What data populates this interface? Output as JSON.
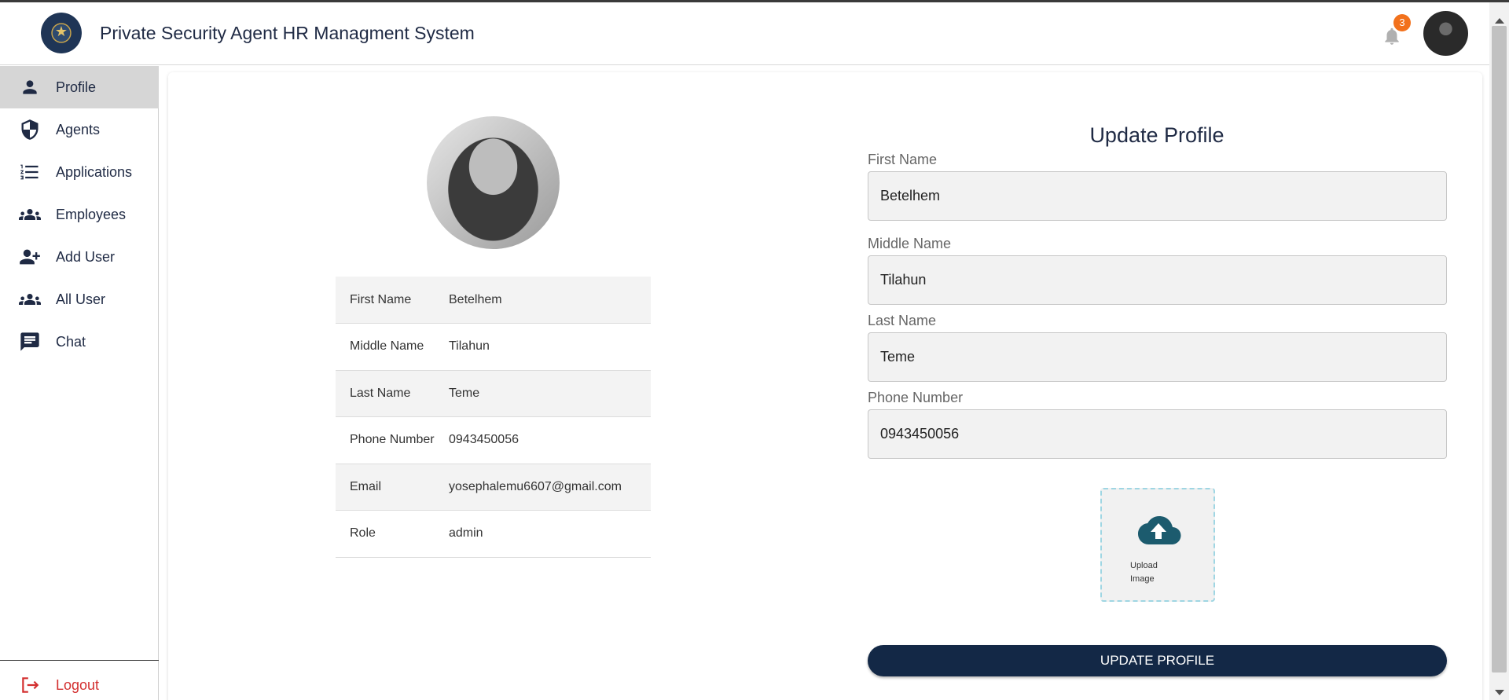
{
  "header": {
    "title": "Private Security Agent HR Managment System",
    "notification_count": "3",
    "logo_icon": "police-emblem",
    "bell_icon": "bell-icon"
  },
  "sidebar": {
    "items": [
      {
        "label": "Profile",
        "icon": "person-icon",
        "active": true
      },
      {
        "label": "Agents",
        "icon": "shield-icon"
      },
      {
        "label": "Applications",
        "icon": "list-icon"
      },
      {
        "label": "Employees",
        "icon": "group-icon"
      },
      {
        "label": "Add User",
        "icon": "person-add-icon"
      },
      {
        "label": "All User",
        "icon": "group-icon"
      },
      {
        "label": "Chat",
        "icon": "chat-icon"
      }
    ],
    "logout_label": "Logout"
  },
  "profile": {
    "rows": [
      {
        "key": "First Name",
        "value": "Betelhem"
      },
      {
        "key": "Middle Name",
        "value": "Tilahun"
      },
      {
        "key": "Last Name",
        "value": "Teme"
      },
      {
        "key": "Phone Number",
        "value": "0943450056"
      },
      {
        "key": "Email",
        "value": "yosephalemu6607@gmail.com"
      },
      {
        "key": "Role",
        "value": "admin"
      }
    ]
  },
  "form": {
    "title": "Update Profile",
    "first_name_label": "First Name",
    "first_name_value": "Betelhem",
    "middle_name_label": "Middle Name",
    "middle_name_value": "Tilahun",
    "last_name_label": "Last Name",
    "last_name_value": "Teme",
    "phone_label": "Phone Number",
    "phone_value": "0943450056",
    "upload_label": "Upload Image",
    "submit_label": "UPDATE PROFILE"
  },
  "colors": {
    "navy": "#132846",
    "badge": "#f2711c",
    "logout": "#d32f2f",
    "upload_icon": "#1c5b6e"
  }
}
